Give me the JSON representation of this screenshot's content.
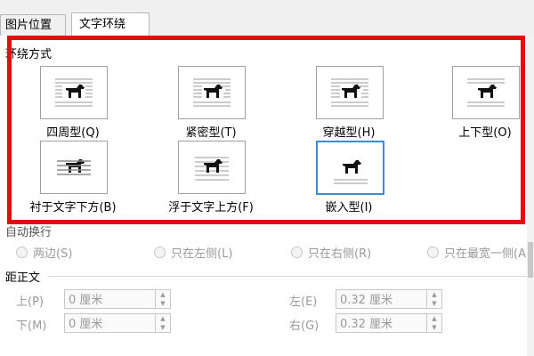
{
  "tabs": [
    {
      "label": "图片位置"
    },
    {
      "label": "文字环绕"
    }
  ],
  "wrap_section": {
    "title": "环绕方式",
    "options": [
      {
        "label": "四周型(Q)"
      },
      {
        "label": "紧密型(T)"
      },
      {
        "label": "穿越型(H)"
      },
      {
        "label": "上下型(O)"
      },
      {
        "label": "衬于文字下方(B)"
      },
      {
        "label": "浮于文字上方(F)"
      },
      {
        "label": "嵌入型(I)"
      }
    ],
    "selected": "嵌入型(I)"
  },
  "auto_wrap_section": {
    "title": "自动换行",
    "options": [
      {
        "label": "两边(S)"
      },
      {
        "label": "只在左侧(L)"
      },
      {
        "label": "只在右侧(R)"
      },
      {
        "label": "只在最宽一侧(A)"
      }
    ]
  },
  "distance_section": {
    "title": "距正文",
    "fields": {
      "top": {
        "label": "上(P)",
        "value": "0 厘米"
      },
      "bottom": {
        "label": "下(M)",
        "value": "0 厘米"
      },
      "left": {
        "label": "左(E)",
        "value": "0.32 厘米"
      },
      "right": {
        "label": "右(G)",
        "value": "0.32 厘米"
      }
    }
  },
  "colors": {
    "highlight": "#e40c0c",
    "selected_border": "#3c8ad8"
  },
  "icons": {
    "wrap_preview": "dog-icon"
  }
}
